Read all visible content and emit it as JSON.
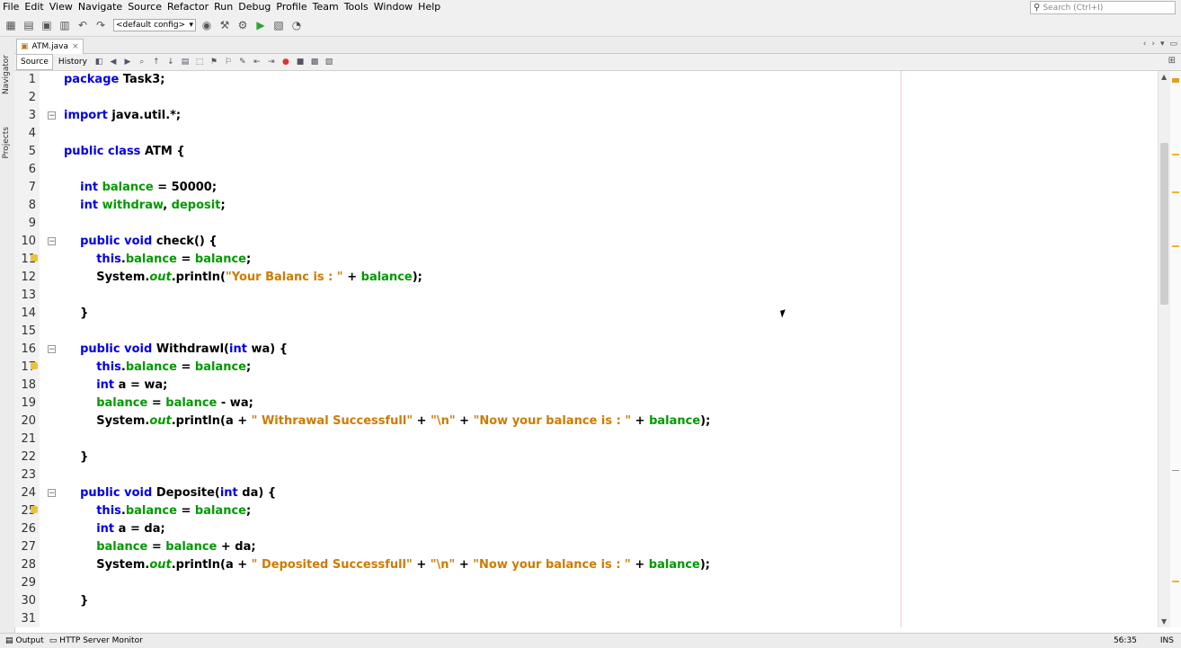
{
  "menu": [
    "File",
    "Edit",
    "View",
    "Navigate",
    "Source",
    "Refactor",
    "Run",
    "Debug",
    "Profile",
    "Team",
    "Tools",
    "Window",
    "Help"
  ],
  "search": {
    "placeholder": "Search (Ctrl+I)"
  },
  "toolbar": {
    "config": "<default config>"
  },
  "side_tabs": {
    "navigator": "Navigator",
    "projects": "Projects"
  },
  "file_tab": {
    "name": "ATM.java",
    "close": "×"
  },
  "editor_tabs": {
    "source": "Source",
    "history": "History"
  },
  "lines": [
    {
      "n": "1",
      "code": "<span class=\"kw\">package</span> Task3;"
    },
    {
      "n": "2",
      "code": ""
    },
    {
      "n": "3",
      "code": "<span class=\"kw\">import</span> java.util.*;"
    },
    {
      "n": "4",
      "code": ""
    },
    {
      "n": "5",
      "code": "<span class=\"kw\">public class</span> ATM {"
    },
    {
      "n": "6",
      "code": ""
    },
    {
      "n": "7",
      "code": "    <span class=\"kw\">int</span> <span class=\"fld\">balance</span> = 50000;"
    },
    {
      "n": "8",
      "code": "    <span class=\"kw\">int</span> <span class=\"fld\">withdraw</span>, <span class=\"fld\">deposit</span>;"
    },
    {
      "n": "9",
      "code": ""
    },
    {
      "n": "10",
      "code": "    <span class=\"kw\">public void</span> check() {"
    },
    {
      "n": "11",
      "code": "        <span class=\"kw\">this</span>.<span class=\"fld\">balance</span> = <span class=\"fld\">balance</span>;"
    },
    {
      "n": "12",
      "code": "        System.<span class=\"st\">out</span>.println(<span class=\"str\">\"Your Balanc is : \"</span> + <span class=\"fld\">balance</span>);"
    },
    {
      "n": "13",
      "code": ""
    },
    {
      "n": "14",
      "code": "    }"
    },
    {
      "n": "15",
      "code": ""
    },
    {
      "n": "16",
      "code": "    <span class=\"kw\">public void</span> Withdrawl(<span class=\"kw\">int</span> wa) {"
    },
    {
      "n": "17",
      "code": "        <span class=\"kw\">this</span>.<span class=\"fld\">balance</span> = <span class=\"fld\">balance</span>;"
    },
    {
      "n": "18",
      "code": "        <span class=\"kw\">int</span> a = wa;"
    },
    {
      "n": "19",
      "code": "        <span class=\"fld\">balance</span> = <span class=\"fld\">balance</span> - wa;"
    },
    {
      "n": "20",
      "code": "        System.<span class=\"st\">out</span>.println(a + <span class=\"str\">\" Withrawal Successfull\"</span> + <span class=\"str\">\"\\n\"</span> + <span class=\"str\">\"Now your balance is : \"</span> + <span class=\"fld\">balance</span>);"
    },
    {
      "n": "21",
      "code": ""
    },
    {
      "n": "22",
      "code": "    }"
    },
    {
      "n": "23",
      "code": ""
    },
    {
      "n": "24",
      "code": "    <span class=\"kw\">public void</span> Deposite(<span class=\"kw\">int</span> da) {"
    },
    {
      "n": "25",
      "code": "        <span class=\"kw\">this</span>.<span class=\"fld\">balance</span> = <span class=\"fld\">balance</span>;"
    },
    {
      "n": "26",
      "code": "        <span class=\"kw\">int</span> a = da;"
    },
    {
      "n": "27",
      "code": "        <span class=\"fld\">balance</span> = <span class=\"fld\">balance</span> + da;"
    },
    {
      "n": "28",
      "code": "        System.<span class=\"st\">out</span>.println(a + <span class=\"str\">\" Deposited Successfull\"</span> + <span class=\"str\">\"\\n\"</span> + <span class=\"str\">\"Now your balance is : \"</span> + <span class=\"fld\">balance</span>);"
    },
    {
      "n": "29",
      "code": ""
    },
    {
      "n": "30",
      "code": "    }"
    },
    {
      "n": "31",
      "code": ""
    }
  ],
  "fold_lines": [
    "3",
    "10",
    "16",
    "24"
  ],
  "lock_lines": [
    "11",
    "17",
    "25"
  ],
  "status": {
    "output": "Output",
    "http": "HTTP Server Monitor",
    "position": "56:35",
    "mode": "INS"
  },
  "colors": {
    "keyword": "#0000e6",
    "field": "#009900",
    "string": "#ce7b00"
  }
}
